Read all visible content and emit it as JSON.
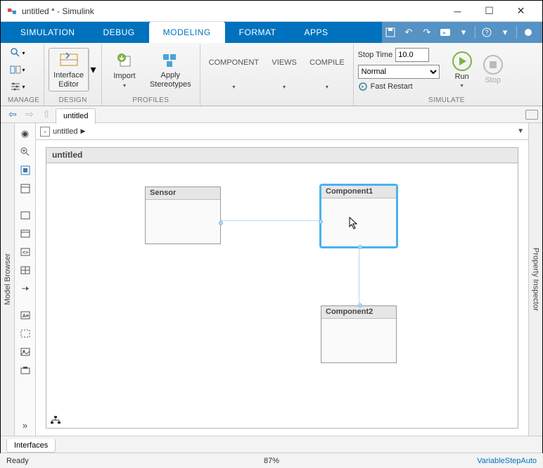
{
  "window": {
    "title": "untitled * - Simulink"
  },
  "ribbon": {
    "tabs": [
      "SIMULATION",
      "DEBUG",
      "MODELING",
      "FORMAT",
      "APPS"
    ],
    "active": 2
  },
  "toolstrip": {
    "manage_label": "MANAGE",
    "design_label": "DESIGN",
    "profiles_label": "PROFILES",
    "simulate_label": "SIMULATE",
    "interface_editor": "Interface\nEditor",
    "import": "Import",
    "apply_stereotypes": "Apply\nStereotypes",
    "component": "COMPONENT",
    "views": "VIEWS",
    "compile": "COMPILE",
    "stop_time_label": "Stop Time",
    "stop_time_value": "10.0",
    "mode": "Normal",
    "fast_restart": "Fast Restart",
    "run": "Run",
    "stop": "Stop"
  },
  "nav": {
    "tab": "untitled"
  },
  "crumb": {
    "root": "untitled"
  },
  "diagram": {
    "title": "untitled",
    "blocks": {
      "sensor": "Sensor",
      "comp1": "Component1",
      "comp2": "Component2"
    }
  },
  "left_panel": "Model Browser",
  "right_panel": "Property Inspector",
  "bottom_tab": "Interfaces",
  "status": {
    "left": "Ready",
    "center": "87%",
    "right": "VariableStepAuto"
  }
}
